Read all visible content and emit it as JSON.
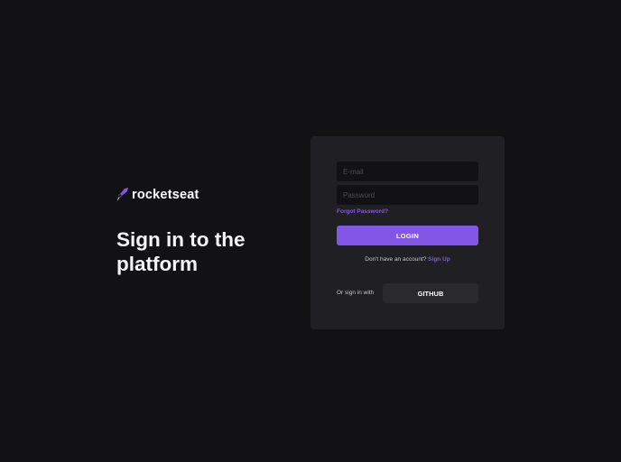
{
  "brand": {
    "name": "rocketseat",
    "icon": "rocket-logo-icon",
    "accent_color": "#8257e5"
  },
  "headline": "Sign in to the platform",
  "form": {
    "email_placeholder": "E-mail",
    "password_placeholder": "Password",
    "forgot_label": "Forgot Password?",
    "login_label": "LOGIN",
    "signup_prompt": "Don't have an account?",
    "signup_link": "Sign Up"
  },
  "social": {
    "label": "Or sign in with",
    "github_label": "GITHUB"
  }
}
